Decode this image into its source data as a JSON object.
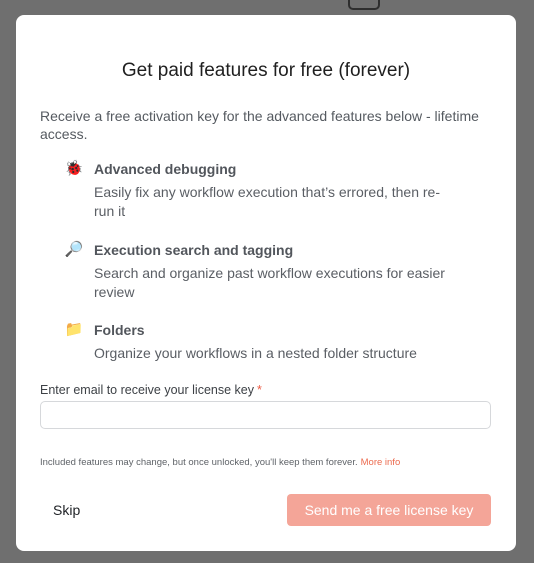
{
  "modal": {
    "title": "Get paid features for free (forever)",
    "intro": "Receive a free activation key for the advanced features below - lifetime access."
  },
  "features": [
    {
      "icon": "ladybug-icon",
      "glyph": "🐞",
      "title": "Advanced debugging",
      "description": "Easily fix any workflow execution that’s errored, then re-run it"
    },
    {
      "icon": "magnifying-glass-icon",
      "glyph": "🔎",
      "title": "Execution search and tagging",
      "description": "Search and organize past workflow executions for easier review"
    },
    {
      "icon": "folder-icon",
      "glyph": "📁",
      "title": "Folders",
      "description": "Organize your workflows in a nested folder structure"
    }
  ],
  "form": {
    "email_label": "Enter email to receive your license key",
    "required_marker": "*",
    "email_value": "",
    "email_placeholder": ""
  },
  "disclaimer": {
    "text": "Included features may change, but once unlocked, you'll keep them forever.",
    "link": "More info"
  },
  "actions": {
    "skip_label": "Skip",
    "send_label": "Send me a free license key"
  },
  "colors": {
    "overlay": "#6f6f6f",
    "primary_disabled": "#f4a598",
    "accent_link": "#ec6b4f",
    "required": "#ec5a43"
  }
}
